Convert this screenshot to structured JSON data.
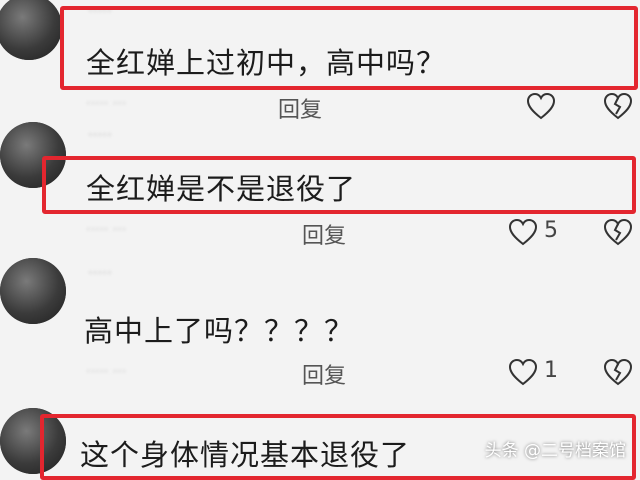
{
  "comments": [
    {
      "username": "·····",
      "text": "全红婵上过初中，高中吗？",
      "meta": "·····  ···",
      "reply_label": "回复",
      "like_count": ""
    },
    {
      "username": "·····",
      "text": "全红婵是不是退役了",
      "meta": "·····  ···",
      "reply_label": "回复",
      "like_count": "5"
    },
    {
      "username": "·····",
      "text": "高中上了吗？？？？",
      "meta": "·····  ···",
      "reply_label": "回复",
      "like_count": "1"
    },
    {
      "username": "",
      "text": "这个身体情况基本退役了"
    }
  ],
  "watermark": "头条 @二号档案馆",
  "colors": {
    "highlight": "#e3262f",
    "background": "#f3f3f3"
  }
}
